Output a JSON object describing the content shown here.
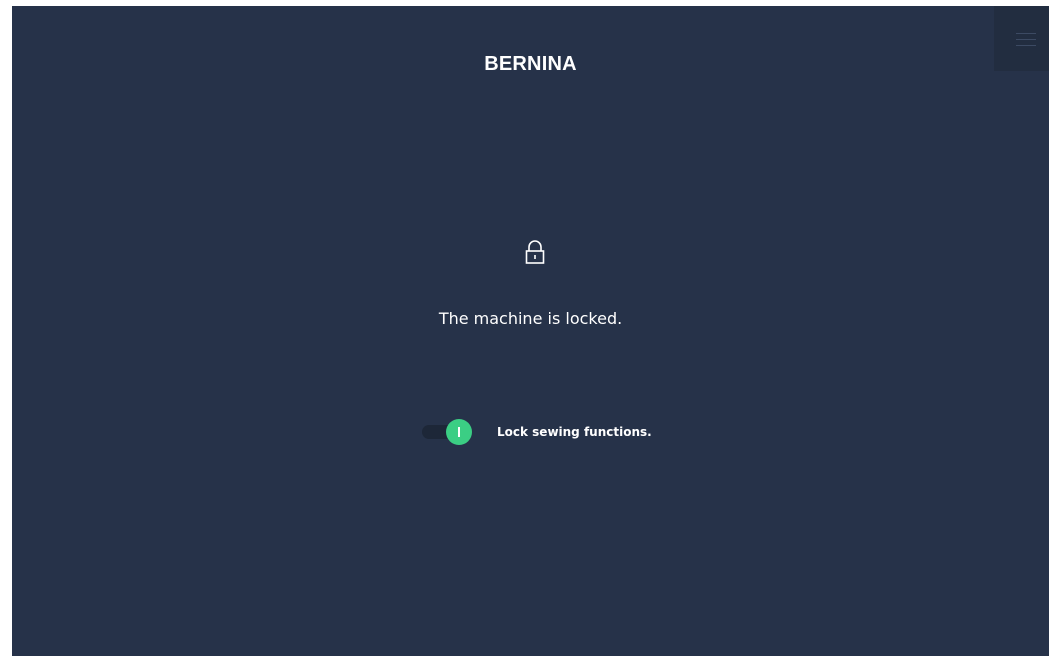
{
  "header": {
    "brand": "BERNINA",
    "menu_icon": "hamburger-icon"
  },
  "lock_screen": {
    "icon": "lock-icon",
    "message": "The machine is locked."
  },
  "sewing_lock_toggle": {
    "label": "Lock sewing functions.",
    "state": "on",
    "knob_symbol": "I"
  },
  "colors": {
    "background": "#263249",
    "menu_background": "#222d40",
    "toggle_on": "#3bce84",
    "toggle_track": "#1d2738",
    "text": "#ffffff"
  }
}
